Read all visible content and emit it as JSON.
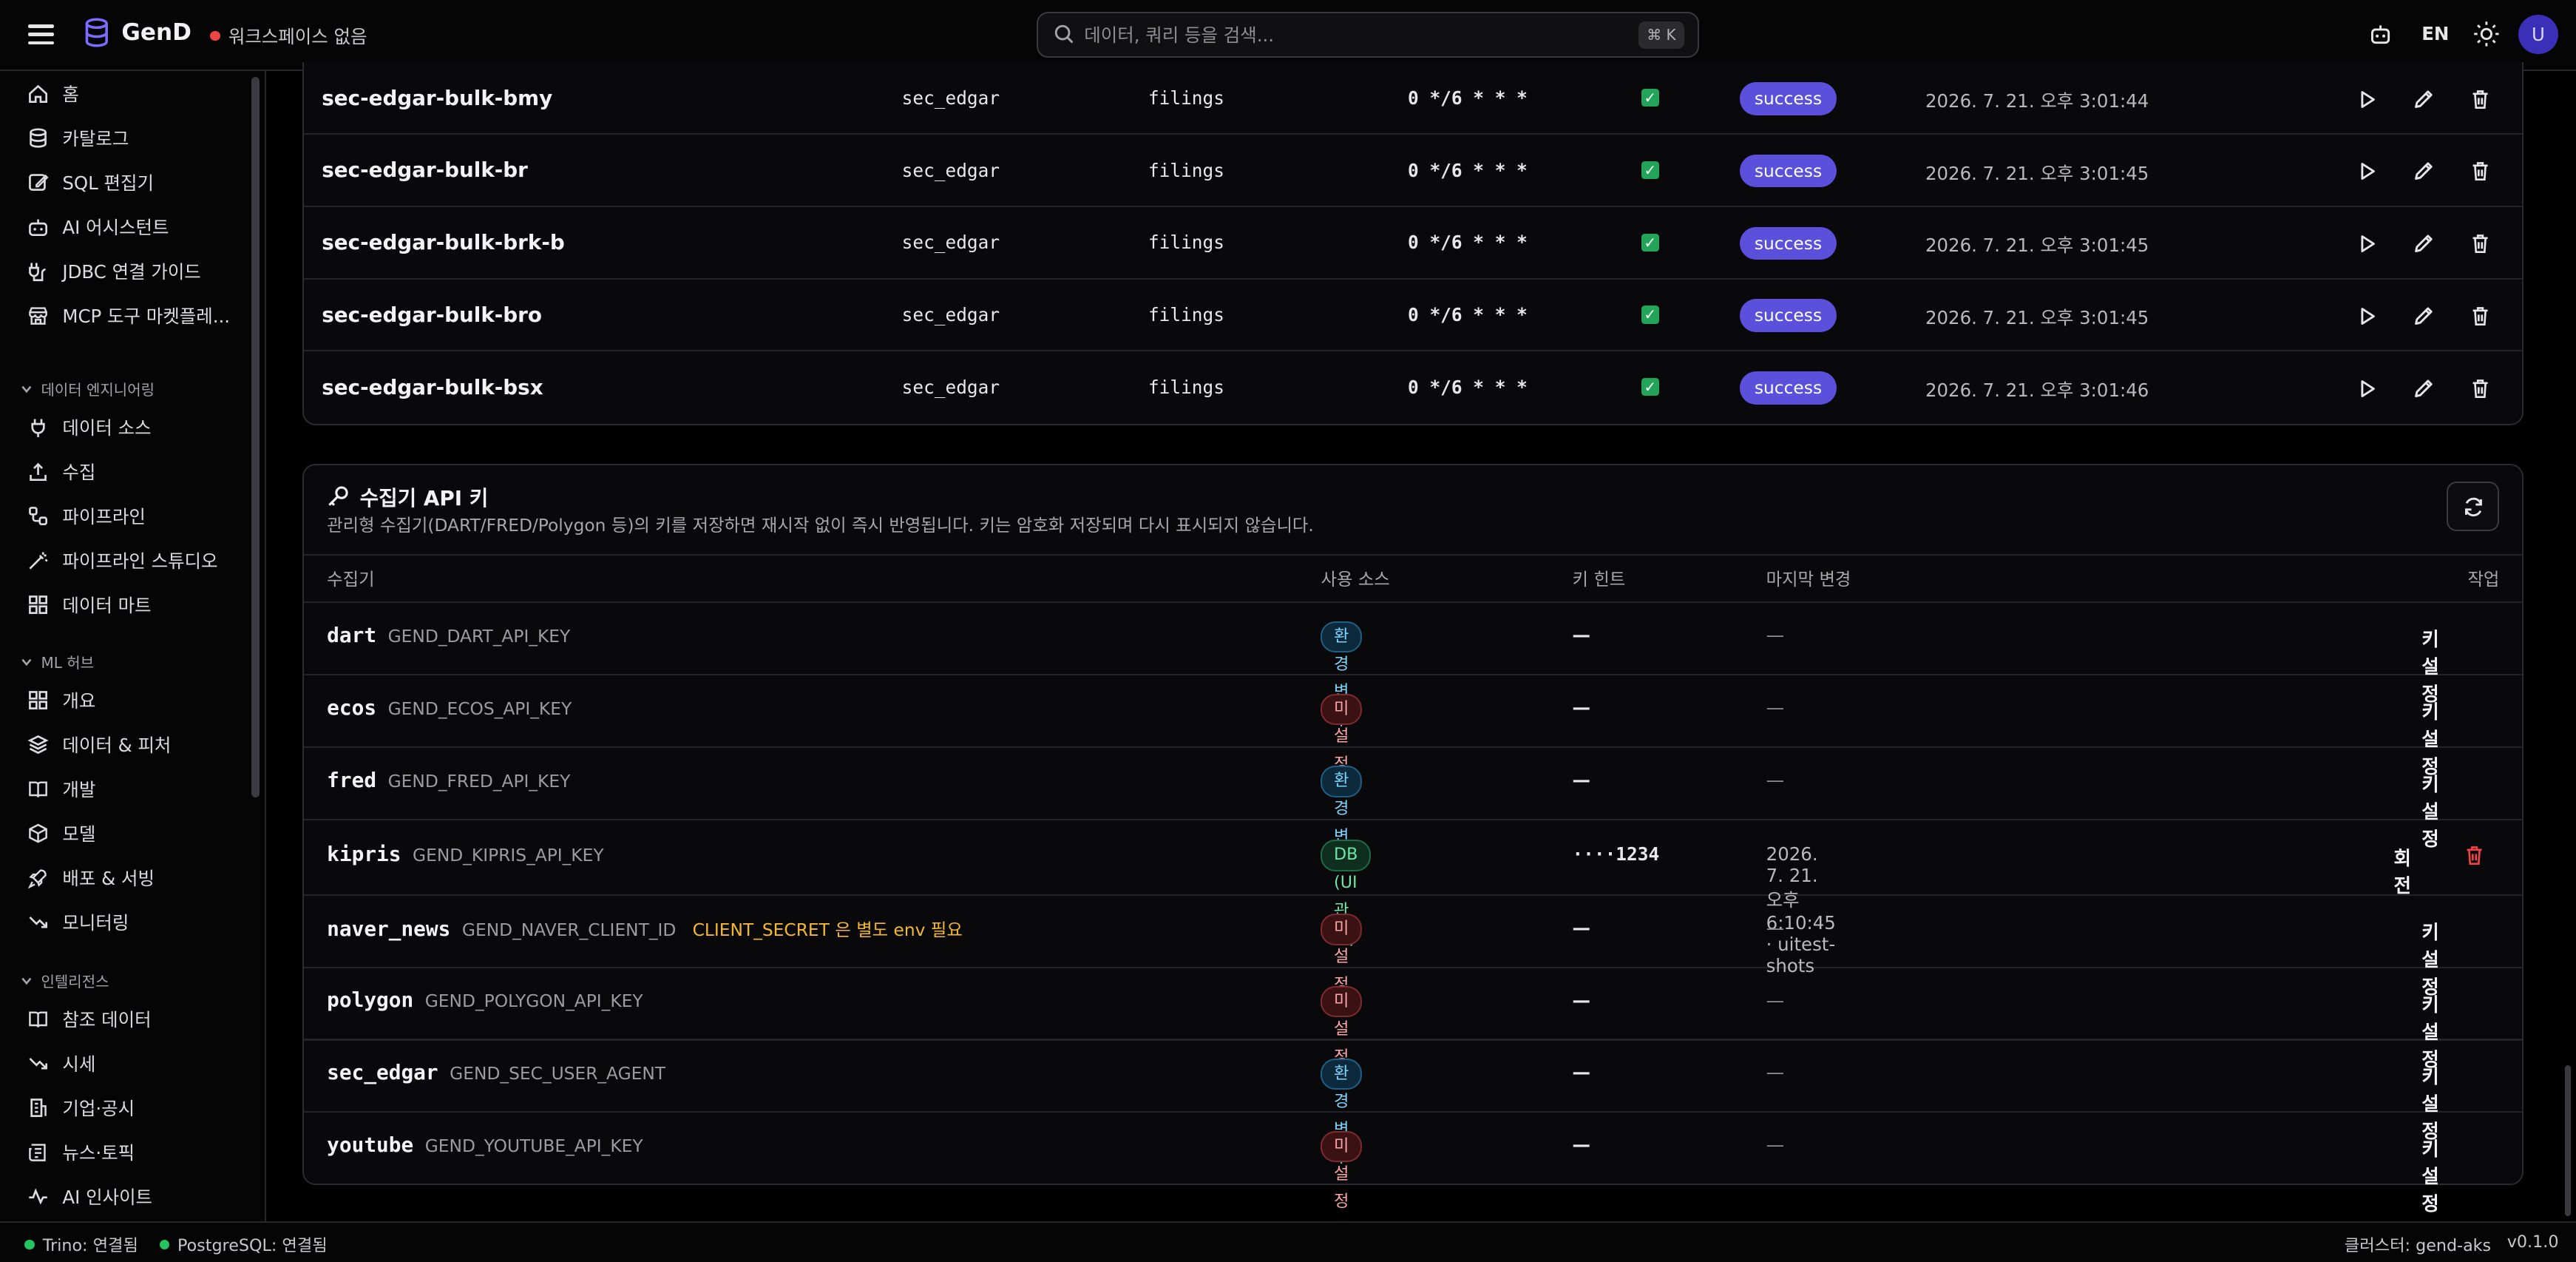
{
  "app": {
    "name": "GenD",
    "workspace": "워크스페이스 없음"
  },
  "search": {
    "placeholder": "데이터, 쿼리 등을 검색...",
    "shortcut": "⌘ K"
  },
  "header": {
    "lang": "EN",
    "avatar": "U"
  },
  "sidebar": {
    "items": [
      {
        "label": "홈",
        "icon": "home-icon"
      },
      {
        "label": "카탈로그",
        "icon": "database-icon"
      },
      {
        "label": "SQL 편집기",
        "icon": "edit-icon"
      },
      {
        "label": "AI 어시스턴트",
        "icon": "bot-icon"
      },
      {
        "label": "JDBC 연결 가이드",
        "icon": "cable-icon"
      },
      {
        "label": "MCP 도구 마켓플레...",
        "icon": "store-icon"
      }
    ],
    "groups": [
      {
        "label": "데이터 엔지니어링",
        "items": [
          {
            "label": "데이터 소스",
            "icon": "plug-icon"
          },
          {
            "label": "수집",
            "icon": "upload-icon"
          },
          {
            "label": "파이프라인",
            "icon": "workflow-icon"
          },
          {
            "label": "파이프라인 스튜디오",
            "icon": "wand-icon"
          },
          {
            "label": "데이터 마트",
            "icon": "grid-icon"
          }
        ]
      },
      {
        "label": "ML 허브",
        "items": [
          {
            "label": "개요",
            "icon": "grid-icon"
          },
          {
            "label": "데이터 & 피처",
            "icon": "layers-icon"
          },
          {
            "label": "개발",
            "icon": "book-icon"
          },
          {
            "label": "모델",
            "icon": "box-icon"
          },
          {
            "label": "배포 & 서빙",
            "icon": "rocket-icon"
          },
          {
            "label": "모니터링",
            "icon": "trend-down-icon"
          }
        ]
      },
      {
        "label": "인텔리전스",
        "items": [
          {
            "label": "참조 데이터",
            "icon": "book-open-icon"
          },
          {
            "label": "시세",
            "icon": "trend-icon"
          },
          {
            "label": "기업·공시",
            "icon": "building-icon"
          },
          {
            "label": "뉴스·토픽",
            "icon": "newspaper-icon"
          },
          {
            "label": "AI 인사이트",
            "icon": "activity-icon"
          }
        ]
      }
    ]
  },
  "jobs": {
    "rows": [
      {
        "name": "sec-edgar-bulk-bmy",
        "source": "sec_edgar",
        "target": "filings",
        "schedule": "0 */6 * * *",
        "enabled": "✓",
        "status": "success",
        "last_run": "2026. 7. 21. 오후 3:01:44"
      },
      {
        "name": "sec-edgar-bulk-br",
        "source": "sec_edgar",
        "target": "filings",
        "schedule": "0 */6 * * *",
        "enabled": "✓",
        "status": "success",
        "last_run": "2026. 7. 21. 오후 3:01:45"
      },
      {
        "name": "sec-edgar-bulk-brk-b",
        "source": "sec_edgar",
        "target": "filings",
        "schedule": "0 */6 * * *",
        "enabled": "✓",
        "status": "success",
        "last_run": "2026. 7. 21. 오후 3:01:45"
      },
      {
        "name": "sec-edgar-bulk-bro",
        "source": "sec_edgar",
        "target": "filings",
        "schedule": "0 */6 * * *",
        "enabled": "✓",
        "status": "success",
        "last_run": "2026. 7. 21. 오후 3:01:45"
      },
      {
        "name": "sec-edgar-bulk-bsx",
        "source": "sec_edgar",
        "target": "filings",
        "schedule": "0 */6 * * *",
        "enabled": "✓",
        "status": "success",
        "last_run": "2026. 7. 21. 오후 3:01:46"
      }
    ]
  },
  "api_keys": {
    "title": "수집기 API 키",
    "description": "관리형 수집기(DART/FRED/Polygon 등)의 키를 저장하면 재시작 없이 즉시 반영됩니다. 키는 암호화 저장되며 다시 표시되지 않습니다.",
    "columns": {
      "collector": "수집기",
      "source": "사용 소스",
      "hint": "키 힌트",
      "changed": "마지막 변경",
      "action": "작업"
    },
    "rows": [
      {
        "name": "dart",
        "env": "GEND_DART_API_KEY",
        "note": "",
        "source": "환경변수",
        "source_type": "env",
        "hint": "—",
        "changed": "—",
        "action": "키 설정"
      },
      {
        "name": "ecos",
        "env": "GEND_ECOS_API_KEY",
        "note": "",
        "source": "미설정",
        "source_type": "unset",
        "hint": "—",
        "changed": "—",
        "action": "키 설정"
      },
      {
        "name": "fred",
        "env": "GEND_FRED_API_KEY",
        "note": "",
        "source": "환경변수",
        "source_type": "env",
        "hint": "—",
        "changed": "—",
        "action": "키 설정"
      },
      {
        "name": "kipris",
        "env": "GEND_KIPRIS_API_KEY",
        "note": "",
        "source": "DB (UI 관리)",
        "source_type": "db",
        "hint": "····1234",
        "changed": "2026. 7. 21. 오후 6:10:45 · uitest-shots",
        "action": "회전"
      },
      {
        "name": "naver_news",
        "env": "GEND_NAVER_CLIENT_ID",
        "note": "CLIENT_SECRET 은 별도 env 필요",
        "source": "미설정",
        "source_type": "unset",
        "hint": "—",
        "changed": "—",
        "action": "키 설정"
      },
      {
        "name": "polygon",
        "env": "GEND_POLYGON_API_KEY",
        "note": "",
        "source": "미설정",
        "source_type": "unset",
        "hint": "—",
        "changed": "—",
        "action": "키 설정"
      },
      {
        "name": "sec_edgar",
        "env": "GEND_SEC_USER_AGENT",
        "note": "",
        "source": "환경변수",
        "source_type": "env",
        "hint": "—",
        "changed": "—",
        "action": "키 설정"
      },
      {
        "name": "youtube",
        "env": "GEND_YOUTUBE_API_KEY",
        "note": "",
        "source": "미설정",
        "source_type": "unset",
        "hint": "—",
        "changed": "—",
        "action": "키 설정"
      }
    ]
  },
  "statusbar": {
    "trino": "Trino: 연결됨",
    "postgres": "PostgreSQL: 연결됨",
    "cluster": "클러스터: gend-aks",
    "version": "v0.1.0"
  },
  "colors": {
    "accent": "#5b50dc",
    "ok": "#22c55e",
    "danger": "#ef4444",
    "warn": "#f5b92b"
  }
}
